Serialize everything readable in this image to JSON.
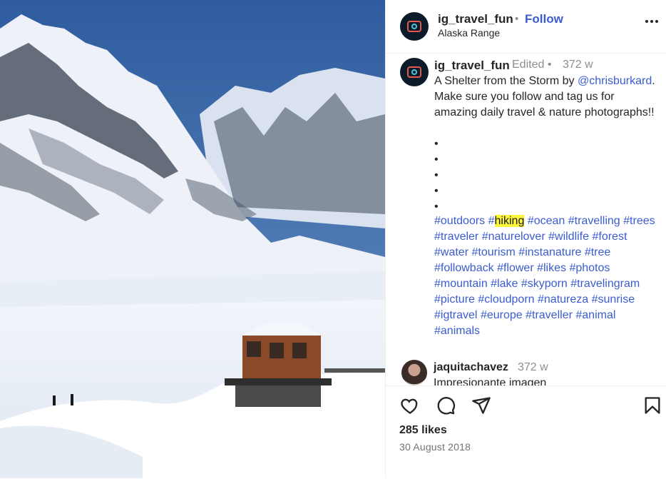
{
  "post": {
    "username": "ig_travel_fun",
    "follow_sep": "•",
    "follow_label": "Follow",
    "location": "Alaska Range"
  },
  "caption": {
    "username": "ig_travel_fun",
    "edited": "Edited •",
    "time": "372 w",
    "text_before": "A Shelter from the Storm by ",
    "mention": "@chrisburkard",
    "text_after": ". Make sure you follow and tag us for amazing daily travel & nature photographs!!",
    "bullets": [
      "•",
      "•",
      "•",
      "•",
      "•"
    ],
    "tags": [
      "#outdoors",
      "#hiking",
      "#ocean",
      "#travelling",
      "#trees",
      "#traveler",
      "#naturelover",
      "#wildlife",
      "#forest",
      "#water",
      "#tourism",
      "#instanature",
      "#tree",
      "#followback",
      "#flower",
      "#likes",
      "#photos",
      "#mountain",
      "#lake",
      "#skyporn",
      "#travelingram",
      "#picture",
      "#cloudporn",
      "#natureza",
      "#sunrise",
      "#igtravel",
      "#europe",
      "#traveller",
      "#animal",
      "#animals"
    ],
    "highlighted_tag": "#hiking"
  },
  "comment": {
    "username": "jaquitachavez",
    "time": "372 w",
    "text": "Impresionante imagen"
  },
  "actions": {
    "icons": [
      "heart-icon",
      "comment-icon",
      "share-icon",
      "bookmark-icon"
    ]
  },
  "likes": "285 likes",
  "date": "30 August 2018",
  "colors": {
    "link": "#3b5ccf",
    "highlight": "#fdf53a",
    "muted": "#8e8e8e"
  }
}
